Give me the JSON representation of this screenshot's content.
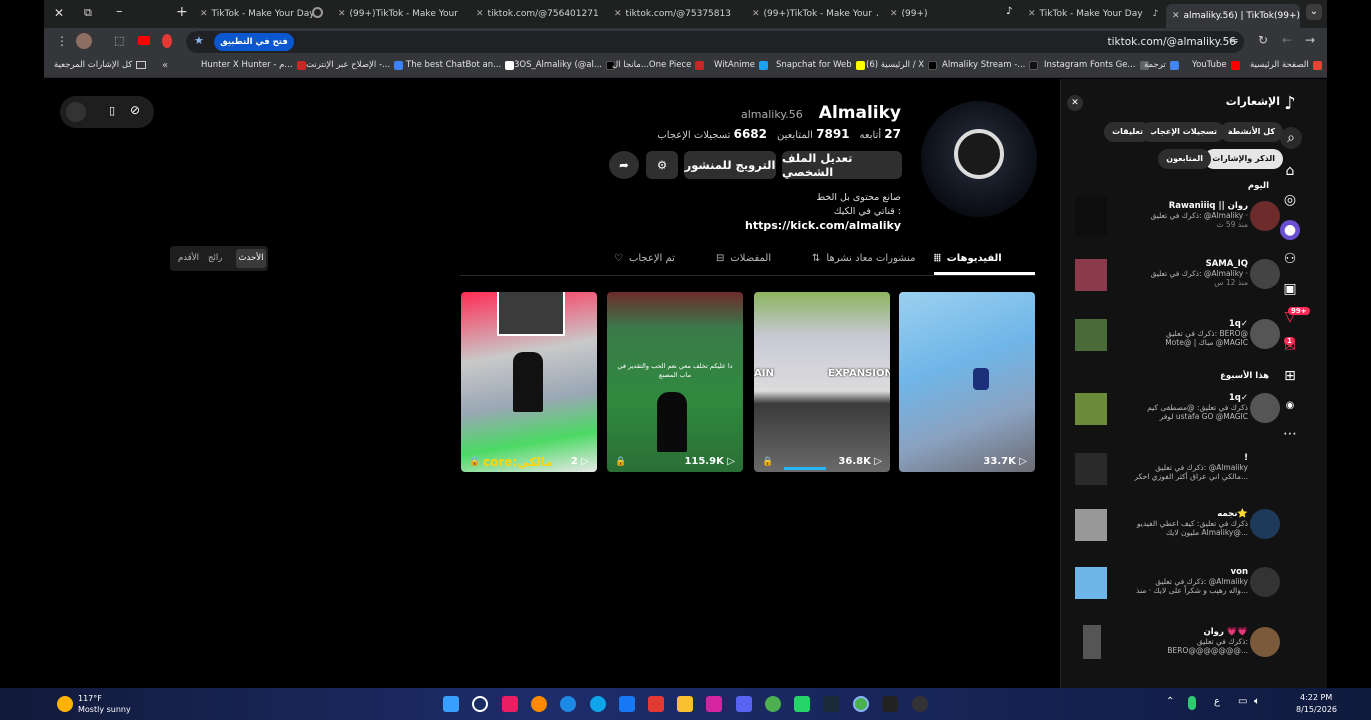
{
  "browser": {
    "tabs": [
      {
        "label": "TikTok - Make Your Day"
      },
      {
        "label": "(99+)TikTok - Make Your"
      },
      {
        "label": "tiktok.com/@756401271"
      },
      {
        "label": "tiktok.com/@75375813"
      },
      {
        "label": "(99+)TikTok - Make Your"
      },
      {
        "label": "(99+)"
      },
      {
        "label": "TikTok - Make Your Day"
      },
      {
        "label": "almaliky.56) | TikTok(99+)"
      }
    ],
    "open_in_app": "فتح في التطبيق",
    "url": "tiktok.com/@almaliky.56",
    "bookmarks": [
      {
        "label": "الصفحة الرئيسية",
        "color": "#ea4335"
      },
      {
        "label": "YouTube",
        "color": "#ff0000"
      },
      {
        "label": "ترجمة",
        "color": "#4285f4"
      },
      {
        "label": "Instagram Fonts Ge...",
        "color": "#5f6368"
      },
      {
        "label": "Almaliky Stream -...",
        "color": "#111111"
      },
      {
        "label": "(6) الرئيسية / X",
        "color": "#000000"
      },
      {
        "label": "Snapchat for Web",
        "color": "#fffc00"
      },
      {
        "label": "WitAnime",
        "color": "#1da1f2"
      },
      {
        "label": "مانجا ال...One Piece",
        "color": "#c62828"
      },
      {
        "label": "3OS_Almaliky (@al...",
        "color": "#000000"
      },
      {
        "label": "The best ChatBot an...",
        "color": "#ffffff"
      },
      {
        "label": "الإصلاح عبر الإنترنت -...",
        "color": "#3b82f6"
      },
      {
        "label": "Hunter X Hunter - م...",
        "color": "#c62828"
      }
    ],
    "bookmarks_folder": "كل الإشارات المرجعية"
  },
  "profile": {
    "display_name": "Almaliky",
    "username": "almaliky.56",
    "following_count": "27",
    "following_label": "أتابعه",
    "followers_count": "7891",
    "followers_label": "المتابعين",
    "likes_count": "6682",
    "likes_label": "تسجيلات الإعجاب",
    "edit_profile": "تعديل الملف الشخصي",
    "promote": "الترويج للمنشور",
    "bio_line1": "صانع محتوى بل الخط",
    "bio_line2": "قناتي في الكيك :",
    "bio_link": "https://kick.com/almaliky"
  },
  "tabs": {
    "videos": "الفيديوهات",
    "reposts": "منشورات معاد نشرها",
    "favorites": "المفضلات",
    "liked": "تم الإعجاب"
  },
  "sort": {
    "latest": "الأحدث",
    "popular": "رائج",
    "oldest": "الأقدم"
  },
  "videos": [
    {
      "views": "33.7K"
    },
    {
      "views": "36.8K",
      "overlay": "EXPANSION",
      "overlay2": "AIN"
    },
    {
      "views": "115.9K",
      "caption": "دا عليكم تخلف معي نعم الحب والتقدير في ماب المصنع"
    },
    {
      "views": "2",
      "caption": "core:مالكي"
    }
  ],
  "notifications": {
    "title": "الإشعارات",
    "filters": [
      "كل الأنشطة",
      "تسجيلات الإعجاب",
      "تعليقات",
      "الذكر والإشارات",
      "المتابعون"
    ],
    "section_today": "اليوم",
    "section_week": "هذا الأسبوع",
    "items": [
      {
        "name": "Rawaniiiq || روان",
        "line1": "ذكرك في تعليق: @Almaliky ·",
        "line2": "منذ 59 ث"
      },
      {
        "name": "SAMA_IQ",
        "line1": "ذكرك في تعليق: @Almaliky ·",
        "line2": "منذ 12 س"
      },
      {
        "name": "1q✓",
        "line1": "ذكرك في تعليق: BERO@",
        "line2": "Mote@ | مباك @MAGIC"
      },
      {
        "name": "1q✓",
        "line1": "ذكرك في تعليق: @مصطفى كيم",
        "line2": "لوفر ustafa GO @MAGIC"
      },
      {
        "name": "!",
        "line1": "ذكرك في تعليق: @Almaliky",
        "line2": "مالكي اني عراق أكثر الفوزي احكر..."
      },
      {
        "name": "نجمه⭐",
        "line1": "ذكرك في تعليق: كيف اعطي الفيديو",
        "line2": "مليون لايك Almaliky@..."
      },
      {
        "name": "von",
        "line1": "ذكرك في تعليق: @Almaliky",
        "line2": "واله رهيب و شكراً على لايك · منذ..."
      },
      {
        "name": "روان 💗💗",
        "line1": "ذكرك في تعليق:",
        "line2": "BERO@@@@@@@..."
      }
    ],
    "badge_inbox": "99+",
    "badge_msg": "1"
  },
  "taskbar": {
    "temperature": "117°F",
    "weather": "Mostly sunny",
    "time": "4:22 PM",
    "date": "8/15/2026",
    "lang": "ع"
  }
}
